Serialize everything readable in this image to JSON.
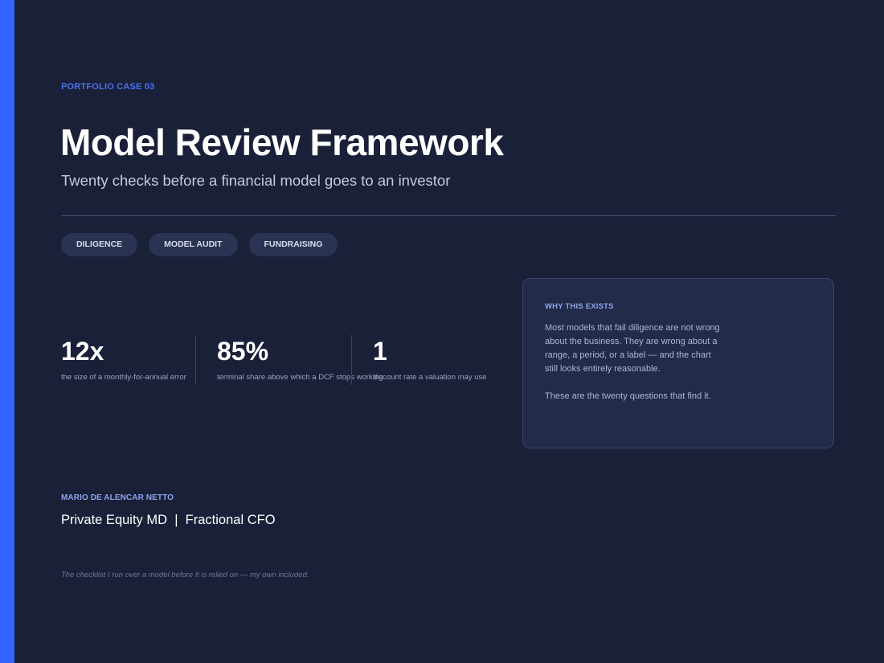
{
  "header": {
    "eyebrow": "PORTFOLIO CASE 03",
    "title": "Model Review Framework",
    "subtitle": "Twenty checks before a financial model goes to an investor"
  },
  "tags": [
    "DILIGENCE",
    "MODEL AUDIT",
    "FUNDRAISING"
  ],
  "stats": [
    {
      "value": "12x",
      "label": "the size of a monthly-for-annual error"
    },
    {
      "value": "85%",
      "label": "terminal share above which a DCF stops working"
    },
    {
      "value": "1",
      "label": "discount rate a valuation may use"
    }
  ],
  "card": {
    "eyebrow": "WHY THIS EXISTS",
    "paragraph_1": "Most models that fail diligence are not wrong about the business. They are wrong about a range, a period, or a label — and the chart still looks entirely reasonable.",
    "paragraph_2": "These are the twenty questions that find it."
  },
  "author": {
    "name": "MARIO DE ALENCAR NETTO",
    "role": "Private Equity MD  |  Fractional CFO"
  },
  "footnote": "The checklist I run over a model before it is relied on — my own included.",
  "colors": {
    "background": "#1a2038",
    "accent": "#3366ff",
    "card": "#232b4a"
  }
}
